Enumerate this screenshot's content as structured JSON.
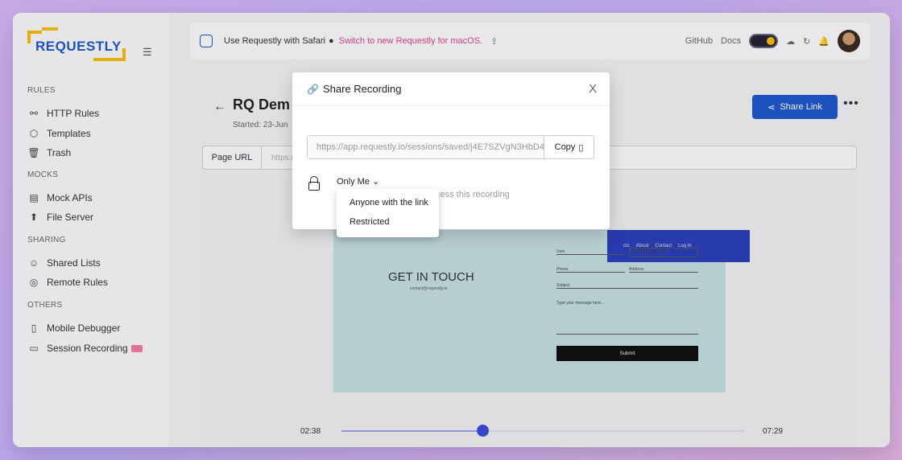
{
  "sidebar": {
    "logo_text": "REQUESTLY",
    "sections": [
      {
        "label": "RULES",
        "items": [
          {
            "label": "HTTP Rules",
            "icon": "rules-icon"
          },
          {
            "label": "Templates",
            "icon": "templates-icon"
          },
          {
            "label": "Trash",
            "icon": "trash-icon"
          }
        ]
      },
      {
        "label": "MOCKS",
        "items": [
          {
            "label": "Mock APIs",
            "icon": "mock-api-icon"
          },
          {
            "label": "File Server",
            "icon": "file-server-icon"
          }
        ]
      },
      {
        "label": "SHARING",
        "items": [
          {
            "label": "Shared Lists",
            "icon": "shared-lists-icon"
          },
          {
            "label": "Remote Rules",
            "icon": "remote-rules-icon"
          }
        ]
      },
      {
        "label": "OTHERS",
        "items": [
          {
            "label": "Mobile Debugger",
            "icon": "mobile-icon"
          },
          {
            "label": "Session Recording",
            "icon": "video-icon",
            "badge": "new"
          }
        ]
      }
    ]
  },
  "topbar": {
    "browser_text": "Use Requestly with Safari",
    "switch_text": "Switch to new Requestly for macOS.",
    "github": "GitHub",
    "docs": "Docs"
  },
  "recording": {
    "title": "RQ Dem",
    "started": "Started: 23-Jun",
    "share_label": "Share Link",
    "url_label": "Page URL",
    "url_value": "https:/"
  },
  "site_preview": {
    "nav": [
      "cts",
      "About",
      "Contact",
      "Log In"
    ],
    "heading": "GET IN TOUCH",
    "email": "contact@requestly.io",
    "fields": [
      "User",
      "user@example.com",
      "Phone",
      "Address",
      "Subject",
      "Type your message here..."
    ],
    "submit": "Submit"
  },
  "player": {
    "current_time": "02:38",
    "total_time": "07:29",
    "progress": 0.35
  },
  "modal": {
    "title": "Share Recording",
    "close": "X",
    "link": "https://app.requestly.io/sessions/saved/j4E7SZVgN3HbD4",
    "copy_label": "Copy",
    "access_value": "Only Me",
    "access_description": "cess this recording"
  },
  "dropdown": {
    "options": [
      "Anyone with the link",
      "Restricted"
    ]
  },
  "colors": {
    "accent": "#1f57c8",
    "pink": "#e0458a",
    "brand_yellow": "#f2b90f"
  }
}
